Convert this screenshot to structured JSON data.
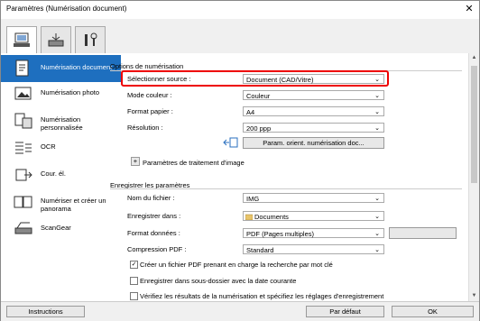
{
  "window": {
    "title": "Paramètres (Numérisation document)"
  },
  "toolbar": {
    "tabs": [
      {
        "icon": "scan-computer-icon"
      },
      {
        "icon": "scan-from-device-icon"
      },
      {
        "icon": "tools-icon"
      }
    ]
  },
  "sidebar": {
    "items": [
      {
        "label": "Numérisation document",
        "icon": "document-scan-icon",
        "active": true
      },
      {
        "label": "Numérisation photo",
        "icon": "photo-scan-icon",
        "active": false
      },
      {
        "label": "Numérisation personnalisée",
        "icon": "custom-scan-icon",
        "active": false
      },
      {
        "label": "OCR",
        "icon": "ocr-icon",
        "active": false
      },
      {
        "label": "Cour. él.",
        "icon": "email-icon",
        "active": false
      },
      {
        "label": "Numériser et créer un panorama",
        "icon": "panorama-icon",
        "active": false
      },
      {
        "label": "ScanGear",
        "icon": "scangear-icon",
        "active": false
      }
    ]
  },
  "scan_options": {
    "heading": "Options de numérisation",
    "source_label": "Sélectionner source :",
    "source_value": "Document (CAD/Vitre)",
    "color_label": "Mode couleur :",
    "color_value": "Couleur",
    "paper_label": "Format papier :",
    "paper_value": "A4",
    "resolution_label": "Résolution :",
    "resolution_value": "200 ppp",
    "orientation_button": "Param. orient. numérisation doc...",
    "image_processing": "Paramètres de traitement d'image",
    "expand_symbol": "+"
  },
  "save_settings": {
    "heading": "Enregistrer les paramètres",
    "filename_label": "Nom du fichier :",
    "filename_value": "IMG",
    "save_in_label": "Enregistrer dans :",
    "save_in_value": "Documents",
    "format_label": "Format données :",
    "format_value": "PDF (Pages multiples)",
    "compression_label": "Compression PDF :",
    "compression_value": "Standard",
    "checkbox1": "Créer un fichier PDF prenant en charge la recherche par mot clé",
    "checkbox1_checked": true,
    "checkbox2": "Enregistrer dans sous-dossier avec la date courante",
    "checkbox2_checked": false,
    "checkbox3": "Vérifiez les résultats de la numérisation et spécifiez les réglages d'enregistrement",
    "checkbox3_checked": false
  },
  "footer": {
    "instructions": "Instructions",
    "defaults": "Par défaut",
    "ok": "OK"
  },
  "colors": {
    "accent": "#1e6fbf",
    "highlight": "#e00000"
  }
}
